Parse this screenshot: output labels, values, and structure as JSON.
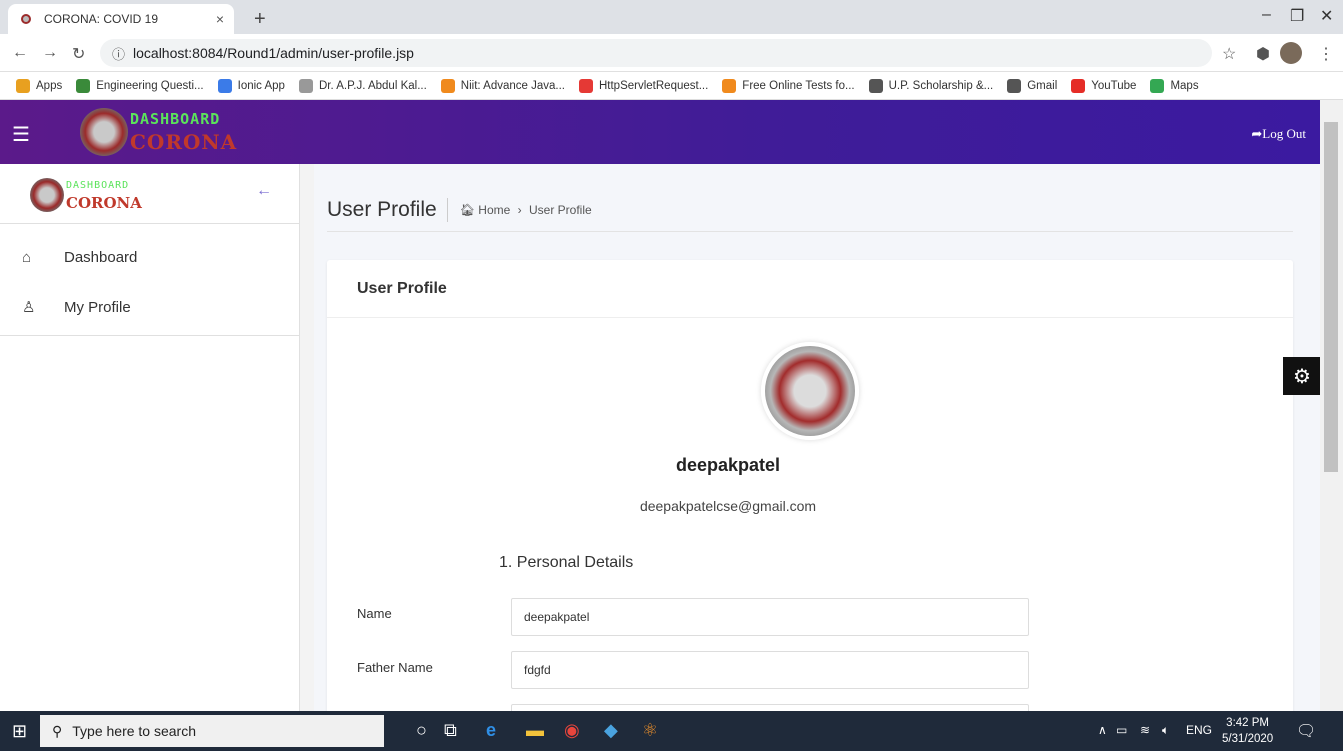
{
  "browser": {
    "tab_title": "CORONA: COVID 19",
    "tab_close": "×",
    "new_tab": "+",
    "url": "localhost:8084/Round1/admin/user-profile.jsp",
    "info_icon": "ⓘ",
    "bookmarks": [
      {
        "label": "Apps",
        "color": "#e8a020"
      },
      {
        "label": "Engineering Questi...",
        "color": "#3a8a3a"
      },
      {
        "label": "Ionic App",
        "color": "#3b7be8"
      },
      {
        "label": "Dr. A.P.J. Abdul Kal...",
        "color": "#999999"
      },
      {
        "label": "Niit: Advance Java...",
        "color": "#f08a1d"
      },
      {
        "label": "HttpServletRequest...",
        "color": "#e53935"
      },
      {
        "label": "Free Online Tests fo...",
        "color": "#f08a1d"
      },
      {
        "label": "U.P. Scholarship &...",
        "color": "#555555"
      },
      {
        "label": "Gmail",
        "color": "#555555"
      },
      {
        "label": "YouTube",
        "color": "#e52d27"
      },
      {
        "label": "Maps",
        "color": "#34a853"
      }
    ]
  },
  "header": {
    "logo_top": "DASHBOARD",
    "logo_bottom": "CORONA",
    "logout": "Log Out",
    "logout_icon": "➦"
  },
  "sidebar": {
    "logo_top": "DASHBOARD",
    "logo_bottom": "CORONA",
    "items": [
      {
        "label": "Dashboard",
        "icon": "home-icon"
      },
      {
        "label": "My Profile",
        "icon": "user-icon"
      }
    ]
  },
  "main": {
    "page_title": "User Profile",
    "breadcrumb_home": "Home",
    "breadcrumb_sep": "›",
    "breadcrumb_current": "User Profile",
    "card_title": "User Profile",
    "username": "deepakpatel",
    "email": "deepakpatelcse@gmail.com",
    "section_title": "1. Personal Details",
    "fields": [
      {
        "label": "Name",
        "value": "deepakpatel"
      },
      {
        "label": "Father Name",
        "value": "fdgfd"
      }
    ]
  },
  "taskbar": {
    "search_placeholder": "Type here to search",
    "lang": "ENG",
    "time": "3:42 PM",
    "date": "5/31/2020"
  },
  "colors": {
    "header_gradient_start": "#5b1a8a",
    "header_gradient_end": "#3b1aa0",
    "logo_green": "#5be35b",
    "logo_red": "#c0392b"
  }
}
